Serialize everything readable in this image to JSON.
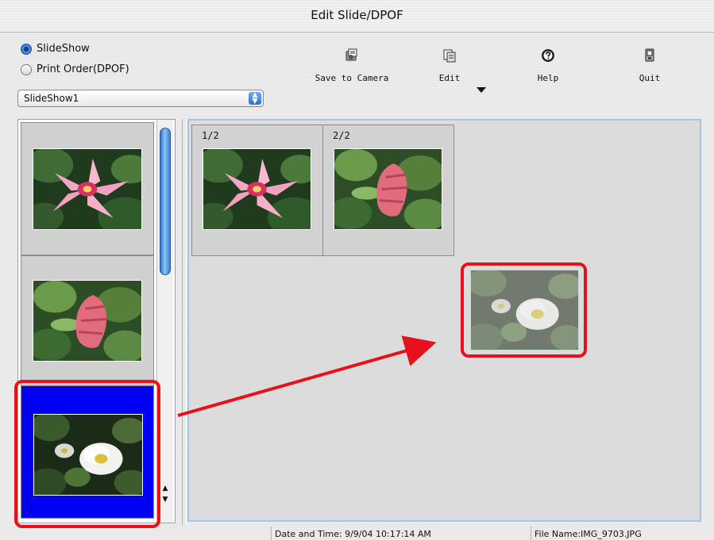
{
  "window": {
    "title": "Edit Slide/DPOF"
  },
  "mode": {
    "options": [
      {
        "label": "SlideShow",
        "selected": true
      },
      {
        "label": "Print Order(DPOF)",
        "selected": false
      }
    ]
  },
  "slideshow_select": {
    "value": "SlideShow1"
  },
  "toolbar": {
    "items": [
      {
        "label": "Save to Camera",
        "icon": "save-to-camera-icon"
      },
      {
        "label": "Edit",
        "icon": "edit-icon",
        "has_dropdown": true
      },
      {
        "label": "Help",
        "icon": "help-icon"
      },
      {
        "label": "Quit",
        "icon": "quit-icon"
      }
    ]
  },
  "image_list": {
    "items": [
      {
        "image": "pink-lily-flower",
        "selected": false
      },
      {
        "image": "pink-shrimp-plant",
        "selected": false
      },
      {
        "image": "white-flower",
        "selected": true
      }
    ]
  },
  "slides": {
    "items": [
      {
        "label": "1/2",
        "image": "pink-lily-flower"
      },
      {
        "label": "2/2",
        "image": "pink-shrimp-plant"
      }
    ],
    "dragging_image": "white-flower"
  },
  "status": {
    "date_time": "Date and Time: 9/9/04 10:17:14 AM",
    "file_name": "File Name:IMG_9703.JPG"
  },
  "colors": {
    "selection": "#0000f2",
    "annotation": "#e8101a",
    "accent": "#2a6fcf"
  }
}
